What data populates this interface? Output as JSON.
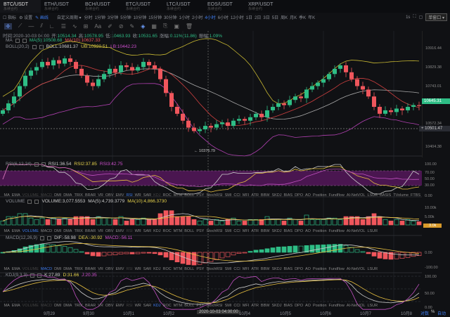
{
  "tabs": [
    {
      "name": "BTC/USDT",
      "sub": "永续合约"
    },
    {
      "name": "ETH/USDT",
      "sub": "永续合约"
    },
    {
      "name": "BCH/USDT",
      "sub": "永续合约"
    },
    {
      "name": "ETC/USDT",
      "sub": "永续合约"
    },
    {
      "name": "LTC/USDT",
      "sub": "永续合约"
    },
    {
      "name": "EOS/USDT",
      "sub": "永续合约"
    },
    {
      "name": "XRP/USDT",
      "sub": "永续合约"
    }
  ],
  "toolbar": {
    "indicator": "指标",
    "settings": "设置",
    "draw": "画线",
    "custom_period": "自定义周期",
    "periods": [
      "分时",
      "1分钟",
      "3分钟",
      "5分钟",
      "10分钟",
      "15分钟",
      "30分钟",
      "1小时",
      "2小时",
      "4小时",
      "6小时",
      "12小时",
      "1日",
      "2日",
      "3日",
      "5日",
      "周K",
      "月K",
      "季K",
      "年K"
    ],
    "active_period": "4小时",
    "interval": "1s",
    "window": "单窗口"
  },
  "info": {
    "time_label": "时间:",
    "time": "2020-10-03 04:00",
    "open_label": "开:",
    "open": "10514.34",
    "high_label": "高:",
    "high": "10578.95",
    "low_label": "低:",
    "low": "10463.93",
    "close_label": "收:",
    "close": "10531.65",
    "change_label": "涨幅:",
    "change": "0.11%(11.86)",
    "amp_label": "振幅:",
    "amp": "1.09%"
  },
  "ma": {
    "label": "MA",
    "ma5": "MA(5):10508.68",
    "ma10": "MA(10):10637.33"
  },
  "boll": {
    "label": "BOLL(20,2)",
    "boll": "BOLL:10681.37",
    "ub": "UB:10920.51",
    "lb": "LB:10442.23"
  },
  "price_axis": [
    "10916.44",
    "10829.38",
    "10743.01",
    "10572.34",
    "10404.38"
  ],
  "current_price": "10645.31",
  "cross_price": "10501.47",
  "low_marker": "10376.79",
  "rsi": {
    "label": "RSI(6,12,24)",
    "rsi1": "RSI1:36.54",
    "rsi2": "RSI2:37.85",
    "rsi3": "RSI3:42.75",
    "axis": [
      "100.00",
      "70.00",
      "50.00",
      "30.00",
      "0.00"
    ]
  },
  "volume": {
    "label": "VOLUME",
    "vol": "VOLUME:3,077.5553",
    "ma5": "MA(5):4,739.3779",
    "ma10": "MA(10):4,866.3730",
    "axis": [
      "10.00k",
      "5.00k"
    ],
    "current": "3.0k"
  },
  "macd": {
    "label": "MACD(12,26,9)",
    "dif": "DIF:-58.98",
    "dea": "DEA:-30.92",
    "macd": "MACD:-56.11",
    "axis": [
      "0.00",
      "-100.00"
    ]
  },
  "kdj": {
    "label": "KDJ(9,3,3)",
    "k": "K:27.89",
    "d": "D:31.66",
    "j": "J:20.35",
    "axis": [
      "100.00",
      "50.00",
      "0.00"
    ]
  },
  "indicators": [
    "MA",
    "EMA",
    "VOLUME",
    "MACD",
    "DMI",
    "DMA",
    "TRIX",
    "BRAR",
    "VR",
    "OBV",
    "EMV",
    "RSI",
    "WR",
    "SAR",
    "KDJ",
    "ROC",
    "MTM",
    "BOLL",
    "PSY",
    "StochRSI",
    "SMI",
    "CCI",
    "MFI",
    "ATR",
    "BBW",
    "SKDJ",
    "BIAS",
    "DPO",
    "AO",
    "Position",
    "Fundflow",
    "AI-NetVOL",
    "LSUR",
    "BASIS",
    "TVolume",
    "FTBS"
  ],
  "dates": [
    "9月29",
    "9月30",
    "10月1",
    "10月2",
    "10月4",
    "10月5",
    "10月6",
    "10月7",
    "10月8"
  ],
  "crosshair_date": "2020-10-03 04:00:00",
  "bottom": {
    "log": "对数",
    "pct": "%",
    "auto": "自动"
  },
  "colors": {
    "up": "#2ebd85",
    "down": "#f0565c",
    "accent": "#3d7cf0"
  },
  "chart_data": {
    "type": "candlestick",
    "closes": [
      10620,
      10660,
      10700,
      10760,
      10820,
      10850,
      10870,
      10900,
      10880,
      10910,
      10890,
      10920,
      10900,
      10860,
      10820,
      10780,
      10760,
      10800,
      10830,
      10860,
      10840,
      10880,
      10870,
      10850,
      10870,
      10900,
      10880,
      10860,
      10800,
      10720,
      10640,
      10600,
      10560,
      10520,
      10500,
      10510,
      10530,
      10520,
      10540,
      10550,
      10530,
      10560,
      10570,
      10560,
      10580,
      10600,
      10580,
      10620,
      10640,
      10660,
      10650,
      10680,
      10700,
      10690,
      10740,
      10760,
      10780,
      10800,
      10830,
      10860,
      10880,
      10840,
      10800,
      10760,
      10740,
      10700,
      10640,
      10600,
      10620,
      10610,
      10630,
      10620,
      10640,
      10650,
      10645
    ],
    "ylim": [
      10404.38,
      10916.44
    ]
  }
}
